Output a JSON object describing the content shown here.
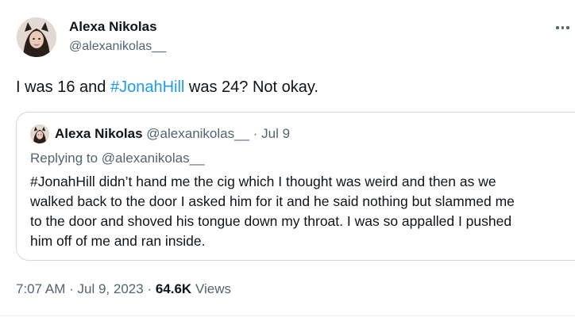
{
  "author": {
    "name": "Alexa Nikolas",
    "handle": "@alexanikolas__"
  },
  "tweet": {
    "text_before": "I was 16 and ",
    "hashtag": "#JonahHill",
    "text_after": " was 24? Not okay."
  },
  "quoted": {
    "name": "Alexa Nikolas",
    "handle": "@alexanikolas__",
    "separator": "·",
    "date": "Jul 9",
    "replying_to": "Replying to @alexanikolas__",
    "body": "#JonahHill didn’t hand me the cig which I thought was weird and then as we\nwalked back to the door I asked him for it and he said nothing but slammed me\nto the door and shoved his tongue down my throat. I was so appalled I pushed\nhim off of me and ran inside."
  },
  "meta": {
    "time": "7:07 AM",
    "sep1": "·",
    "date": "Jul 9, 2023",
    "sep2": "·",
    "views_count": "64.6K",
    "views_label": "Views"
  },
  "colors": {
    "link": "#1d9bf0",
    "secondary_text": "#536471",
    "primary_text": "#0f1419",
    "border": "#cfd9de"
  },
  "icons": {
    "more": "more-horizontal-icon"
  }
}
